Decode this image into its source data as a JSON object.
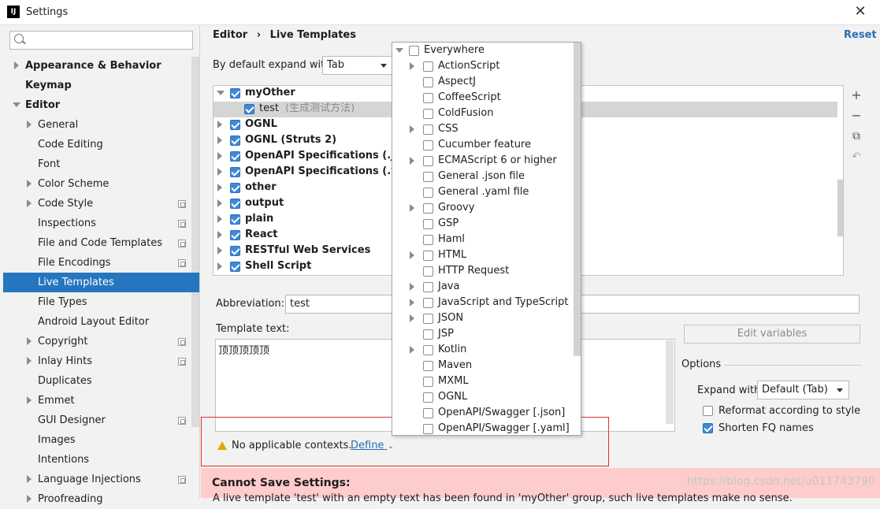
{
  "window": {
    "title": "Settings",
    "app_icon_text": "IJ"
  },
  "search": {
    "placeholder": ""
  },
  "sidebar": {
    "items": [
      {
        "label": "Appearance & Behavior"
      },
      {
        "label": "Keymap"
      },
      {
        "label": "Editor"
      },
      {
        "label": "General"
      },
      {
        "label": "Code Editing"
      },
      {
        "label": "Font"
      },
      {
        "label": "Color Scheme"
      },
      {
        "label": "Code Style"
      },
      {
        "label": "Inspections"
      },
      {
        "label": "File and Code Templates"
      },
      {
        "label": "File Encodings"
      },
      {
        "label": "Live Templates"
      },
      {
        "label": "File Types"
      },
      {
        "label": "Android Layout Editor"
      },
      {
        "label": "Copyright"
      },
      {
        "label": "Inlay Hints"
      },
      {
        "label": "Duplicates"
      },
      {
        "label": "Emmet"
      },
      {
        "label": "GUI Designer"
      },
      {
        "label": "Images"
      },
      {
        "label": "Intentions"
      },
      {
        "label": "Language Injections"
      },
      {
        "label": "Proofreading"
      }
    ]
  },
  "header": {
    "crumb_parent": "Editor",
    "crumb_sep": "›",
    "crumb_current": "Live Templates",
    "reset": "Reset"
  },
  "expand_default": {
    "label": "By default expand with",
    "value": "Tab"
  },
  "templates": {
    "groups": [
      {
        "name": "myOther"
      },
      {
        "name": "test",
        "desc": "(生成测试方法)"
      },
      {
        "name": "OGNL"
      },
      {
        "name": "OGNL (Struts 2)"
      },
      {
        "name": "OpenAPI Specifications (.json)"
      },
      {
        "name": "OpenAPI Specifications (.yaml)"
      },
      {
        "name": "other"
      },
      {
        "name": "output"
      },
      {
        "name": "plain"
      },
      {
        "name": "React"
      },
      {
        "name": "RESTful Web Services"
      },
      {
        "name": "Shell Script"
      }
    ]
  },
  "toolbar": {
    "add": "+",
    "remove": "−",
    "copy": "⧉",
    "restore": "↶"
  },
  "abbreviation": {
    "label": "Abbreviation:",
    "value": "test"
  },
  "template_text": {
    "label": "Template text:",
    "value": "顶顶顶顶顶"
  },
  "edit_variables": "Edit variables",
  "options": {
    "title": "Options",
    "expand_label": "Expand with",
    "expand_value": "Default (Tab)",
    "reformat": "Reformat according to style",
    "shorten": "Shorten FQ names"
  },
  "warning": {
    "text": "No applicable contexts.",
    "define": "Define"
  },
  "error": {
    "title": "Cannot Save Settings:",
    "message": "A live template 'test' with an empty text has been found in 'myOther' group, such live templates make no sense."
  },
  "watermark": "https://blog.csdn.net/u011743790",
  "contexts": {
    "items": [
      {
        "label": "Everywhere"
      },
      {
        "label": "ActionScript"
      },
      {
        "label": "AspectJ"
      },
      {
        "label": "CoffeeScript"
      },
      {
        "label": "ColdFusion"
      },
      {
        "label": "CSS"
      },
      {
        "label": "Cucumber feature"
      },
      {
        "label": "ECMAScript 6 or higher"
      },
      {
        "label": "General .json file"
      },
      {
        "label": "General .yaml file"
      },
      {
        "label": "Groovy"
      },
      {
        "label": "GSP"
      },
      {
        "label": "Haml"
      },
      {
        "label": "HTML"
      },
      {
        "label": "HTTP Request"
      },
      {
        "label": "Java"
      },
      {
        "label": "JavaScript and TypeScript"
      },
      {
        "label": "JSON"
      },
      {
        "label": "JSP"
      },
      {
        "label": "Kotlin"
      },
      {
        "label": "Maven"
      },
      {
        "label": "MXML"
      },
      {
        "label": "OGNL"
      },
      {
        "label": "OpenAPI/Swagger [.json]"
      },
      {
        "label": "OpenAPI/Swagger [.yaml]"
      }
    ]
  }
}
